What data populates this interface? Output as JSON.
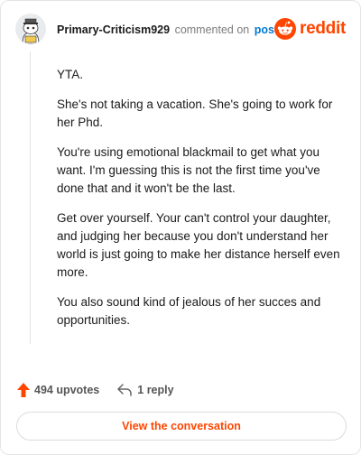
{
  "header": {
    "username": "Primary-Criticism929",
    "action_text": "commented on",
    "post_link": "post",
    "brand": "reddit"
  },
  "comment": {
    "paragraphs": [
      "YTA.",
      "She's not taking a vacation. She's going to work for her Phd.",
      "You're using emotional blackmail to get what you want. I'm guessing this is not the first time you've done that and it won't be the last.",
      "Get over yourself. Your can't control your daughter, and judging her because you don't understand her world is just going to make her distance herself even more.",
      "You also sound kind of jealous of her succes and opportunities."
    ]
  },
  "footer": {
    "upvotes": "494 upvotes",
    "replies": "1 reply"
  },
  "cta": {
    "label": "View the conversation"
  },
  "colors": {
    "brand": "#ff4500",
    "link": "#0079d3",
    "muted": "#7c7c7c"
  },
  "icons": {
    "avatar": "snoo-avatar-icon",
    "brand": "reddit-snoo-icon",
    "upvote": "upvote-arrow-icon",
    "reply": "reply-arrow-icon"
  }
}
